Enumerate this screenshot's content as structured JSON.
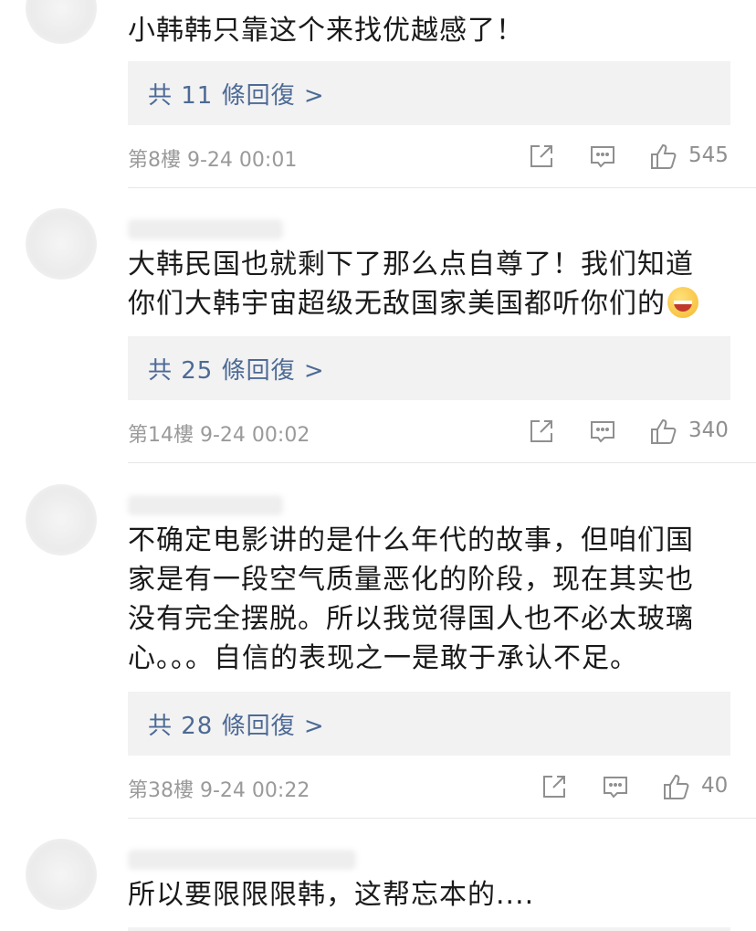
{
  "comments": [
    {
      "text": "小韩韩只靠这个来找优越感了！",
      "replies": "共 11 條回復 >",
      "floor_time": "第8樓  9-24 00:01",
      "likes": "545"
    },
    {
      "text": "大韩民国也就剩下了那么点自尊了！我们知道你们大韩宇宙超级无敌国家美国都听你们的",
      "emoji": "grinning-sweat-emoji",
      "replies": "共 25 條回復 >",
      "floor_time": "第14樓  9-24 00:02",
      "likes": "340"
    },
    {
      "text": "不确定电影讲的是什么年代的故事，但咱们国家是有一段空气质量恶化的阶段，现在其实也没有完全摆脱。所以我觉得国人也不必太玻璃\n心。。。自信的表现之一是敢于承认不足。",
      "replies": "共 28 條回復 >",
      "floor_time": "第38樓  9-24 00:22",
      "likes": "40"
    },
    {
      "text": "所以要限限限韩，这帮忘本的...."
    }
  ],
  "icons": {
    "share": "share-icon",
    "comment": "comment-icon",
    "like": "thumbs-up-icon"
  },
  "colors": {
    "link": "#4d6a95",
    "meta": "#9a9a9a",
    "reply_bg": "#f2f2f2"
  }
}
